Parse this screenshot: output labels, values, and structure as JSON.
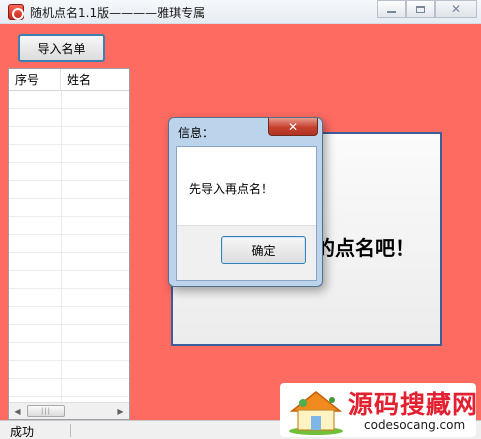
{
  "window": {
    "title": "随机点名1.1版————雅琪专属",
    "icon": "app-icon",
    "controls": {
      "minimize": "minimize-icon",
      "maximize": "maximize-icon",
      "close": "close-icon"
    }
  },
  "toolbar": {
    "import_label": "导入名单"
  },
  "roster": {
    "columns": [
      "序号",
      "姓名"
    ],
    "rows": []
  },
  "panel": {
    "text": "的点名吧！"
  },
  "dialog": {
    "title": "信息：",
    "message": "先导入再点名！",
    "ok_label": "确定"
  },
  "status": {
    "text": "成功"
  },
  "watermark": {
    "main": "源码搜藏网",
    "sub": "codesocang.com"
  },
  "colors": {
    "client_bg": "#fe6b61",
    "accent": "#3c7fb1",
    "logo_red": "#e3202f"
  }
}
